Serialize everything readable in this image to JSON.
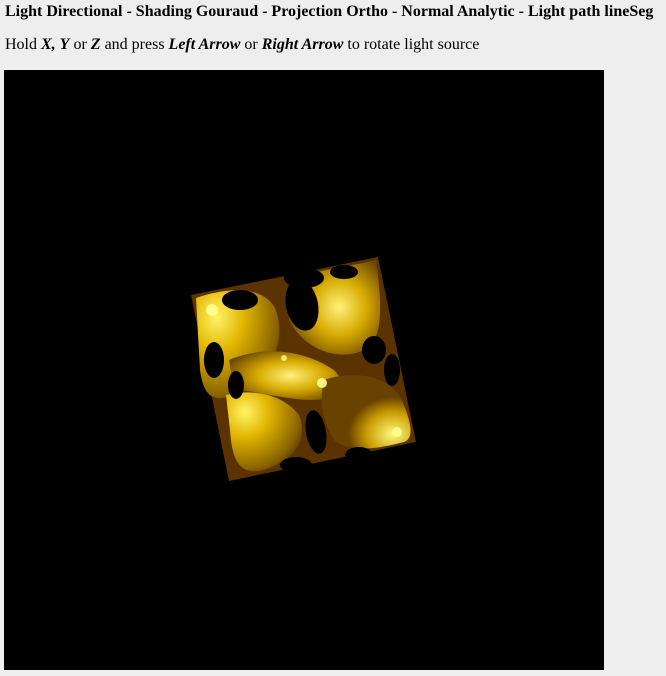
{
  "page": {
    "title": "Light Directional - Shading Gouraud - Projection Ortho - Normal Analytic - Light path lineSeg",
    "instructions": {
      "hold": "Hold",
      "x_key": "X,",
      "y_key": "Y",
      "or1": "or",
      "z_key": "Z",
      "and_press": "and press",
      "left_arrow": "Left Arrow",
      "or2": "or",
      "right_arrow": "Right Arrow",
      "suffix": "to rotate light source"
    }
  },
  "scene": {
    "background": "#000000",
    "surface_color": "#ffd700",
    "surface_shadow": "#5a3200",
    "highlight": "#ffff80"
  }
}
